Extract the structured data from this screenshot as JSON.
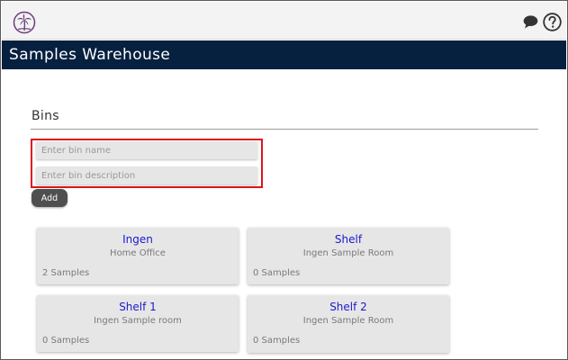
{
  "app": {
    "title": "Samples Warehouse",
    "colors": {
      "app_bar": "#06203f",
      "link": "#1a1acc",
      "highlight": "#e0141a"
    }
  },
  "topbar": {
    "logo_icon": "palm-tree-logo-icon",
    "chat_icon": "speech-bubble-icon",
    "help_icon": "question-mark-circle-icon"
  },
  "bins_section": {
    "title": "Bins",
    "name_input": {
      "placeholder": "Enter bin name",
      "value": ""
    },
    "description_input": {
      "placeholder": "Enter bin description",
      "value": ""
    },
    "add_label": "Add"
  },
  "bins": [
    {
      "name": "Ingen",
      "description": "Home Office",
      "count": "2 Samples"
    },
    {
      "name": "Shelf",
      "description": "Ingen Sample Room",
      "count": "0 Samples"
    },
    {
      "name": "Shelf 1",
      "description": "Ingen Sample room",
      "count": "0 Samples"
    },
    {
      "name": "Shelf 2",
      "description": "Ingen Sample Room",
      "count": "0 Samples"
    }
  ]
}
